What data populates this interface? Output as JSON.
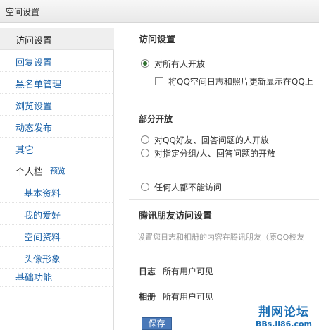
{
  "window": {
    "title": "空间设置"
  },
  "sidebar": {
    "items": [
      {
        "label": "访问设置"
      },
      {
        "label": "回复设置"
      },
      {
        "label": "黑名单管理"
      },
      {
        "label": "浏览设置"
      },
      {
        "label": "动态发布"
      },
      {
        "label": "其它"
      },
      {
        "label": "个人档",
        "extra": "预览"
      },
      {
        "label": "基本资料"
      },
      {
        "label": "我的爱好"
      },
      {
        "label": "空间资料"
      },
      {
        "label": "头像形象"
      },
      {
        "label": "基础功能"
      }
    ]
  },
  "main": {
    "access": {
      "title": "访问设置",
      "open_all": "对所有人开放",
      "show_in_qq": "将QQ空间日志和照片更新显示在QQ上"
    },
    "partial": {
      "title": "部分开放",
      "opt_friends": "对QQ好友、回答问题的人开放",
      "opt_groups": "对指定分组/人、回答问题的开放"
    },
    "none": {
      "label": "任何人都不能访问"
    },
    "tencent": {
      "title": "腾讯朋友访问设置",
      "description": "设置您日志和相册的内容在腾讯朋友（原QQ校友",
      "blog_label": "日志",
      "blog_value": "所有用户可见",
      "album_label": "相册",
      "album_value": "所有用户可见"
    },
    "save_label": "保存"
  },
  "watermark": {
    "text": "荆网论坛",
    "url": "BBs.ii86.com"
  }
}
